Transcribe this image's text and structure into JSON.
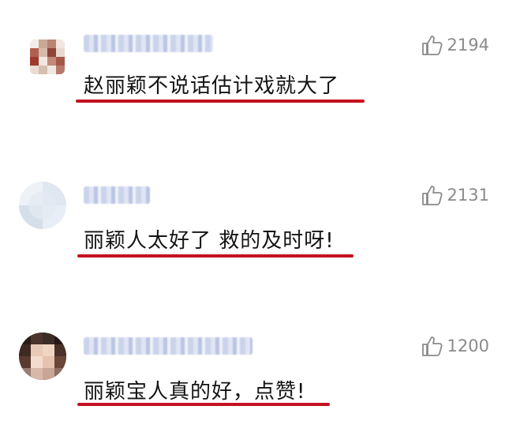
{
  "comments": [
    {
      "username": "",
      "text": "赵丽颖不说话估计戏就大了",
      "likes": "2194",
      "avatar": "pixelated-square-avatar"
    },
    {
      "username": "",
      "text": "丽颖人太好了  救的及时呀!",
      "likes": "2131",
      "avatar": "pixelated-round-avatar-light"
    },
    {
      "username": "",
      "text": "丽颖宝人真的好，点赞!",
      "likes": "1200",
      "avatar": "pixelated-round-avatar-woman"
    }
  ],
  "colors": {
    "underline": "#c4101f",
    "like_text": "#8a8a8a"
  },
  "icons": {
    "like": "thumbs-up-icon"
  }
}
